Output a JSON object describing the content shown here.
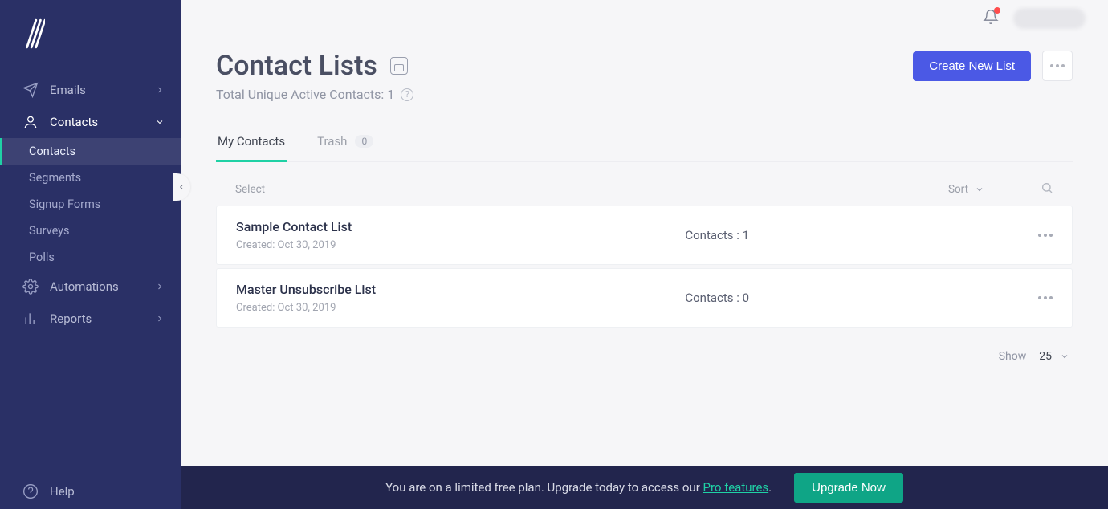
{
  "sidebar": {
    "items": [
      {
        "label": "Emails"
      },
      {
        "label": "Contacts"
      },
      {
        "label": "Automations"
      },
      {
        "label": "Reports"
      }
    ],
    "contacts_sub": [
      {
        "label": "Contacts"
      },
      {
        "label": "Segments"
      },
      {
        "label": "Signup Forms"
      },
      {
        "label": "Surveys"
      },
      {
        "label": "Polls"
      }
    ],
    "help_label": "Help"
  },
  "page": {
    "title": "Contact Lists",
    "subtitle_prefix": "Total Unique Active Contacts: ",
    "subtitle_count": "1",
    "create_button": "Create New List"
  },
  "tabs": {
    "my_contacts": "My Contacts",
    "trash": "Trash",
    "trash_count": "0"
  },
  "list_controls": {
    "select": "Select",
    "sort": "Sort"
  },
  "lists": [
    {
      "title": "Sample Contact List",
      "created": "Created: Oct 30, 2019",
      "contacts_label": "Contacts : 1"
    },
    {
      "title": "Master Unsubscribe List",
      "created": "Created: Oct 30, 2019",
      "contacts_label": "Contacts : 0"
    }
  ],
  "pager": {
    "show_label": "Show",
    "per_page": "25"
  },
  "banner": {
    "text_before": "You are on a limited free plan. Upgrade today to access our ",
    "link_text": "Pro features",
    "text_after": ".",
    "button": "Upgrade Now"
  }
}
